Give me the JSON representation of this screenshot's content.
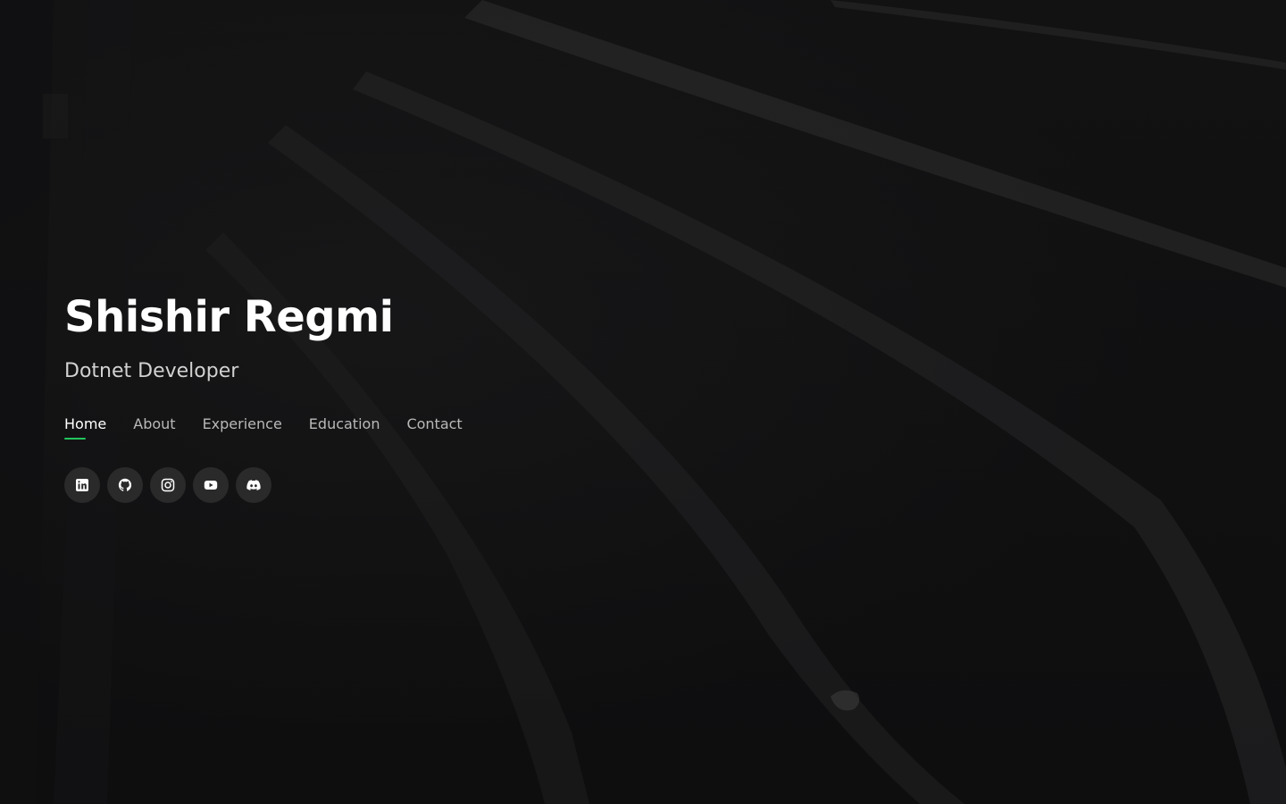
{
  "hero": {
    "name": "Shishir Regmi",
    "role": "Dotnet Developer"
  },
  "nav": {
    "items": [
      {
        "label": "Home",
        "active": true
      },
      {
        "label": "About",
        "active": false
      },
      {
        "label": "Experience",
        "active": false
      },
      {
        "label": "Education",
        "active": false
      },
      {
        "label": "Contact",
        "active": false
      }
    ]
  },
  "socials": [
    {
      "icon": "linkedin-icon"
    },
    {
      "icon": "github-icon"
    },
    {
      "icon": "instagram-icon"
    },
    {
      "icon": "youtube-icon"
    },
    {
      "icon": "discord-icon"
    }
  ],
  "colors": {
    "accent": "#22c55e",
    "background": "#0f0f10",
    "text_primary": "#ffffff",
    "text_secondary": "#b9b9b9"
  }
}
